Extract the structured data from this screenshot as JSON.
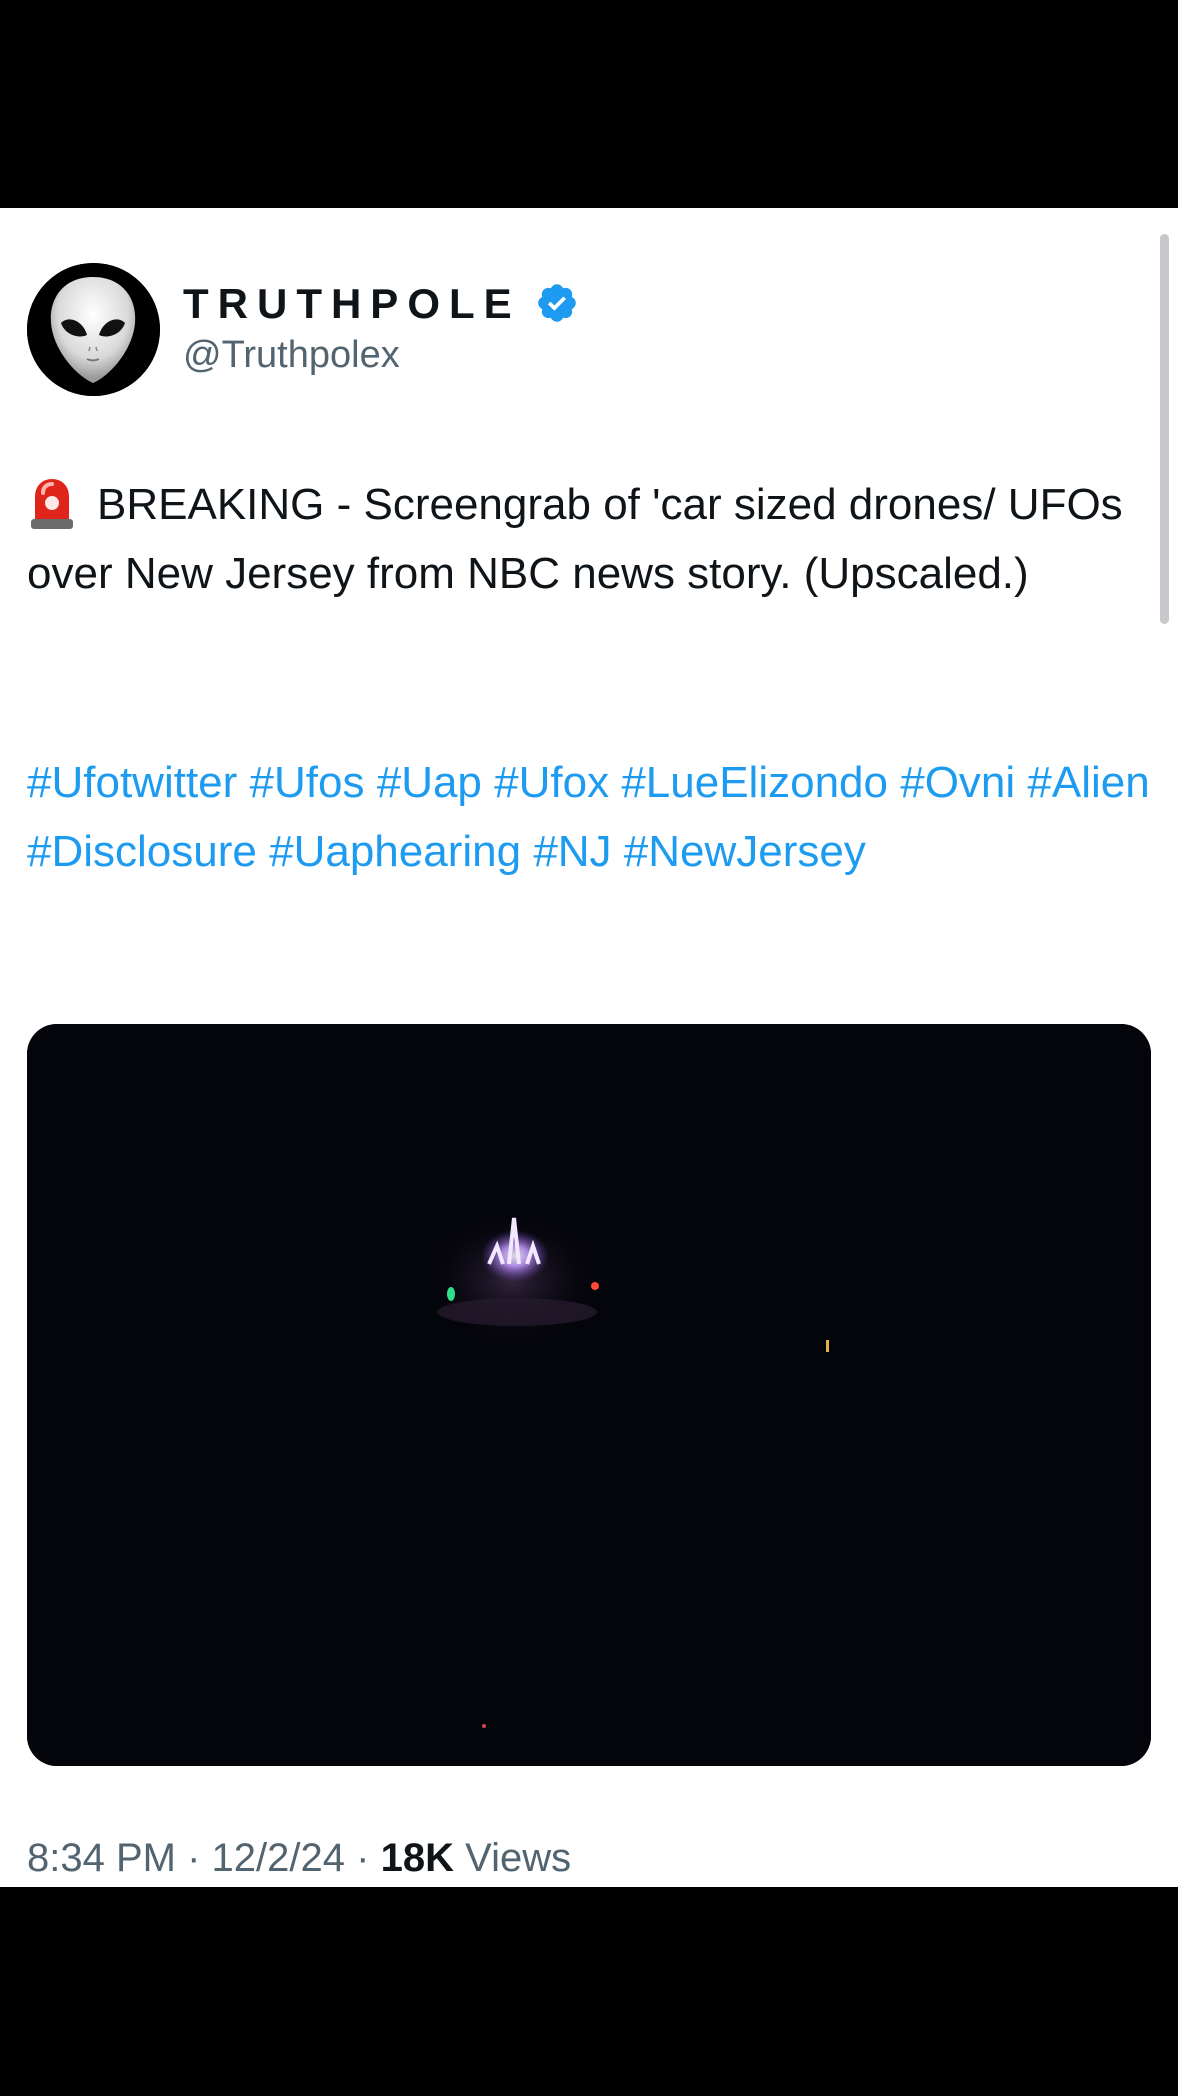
{
  "author": {
    "display_name": "TRUTHPOLE",
    "handle": "@Truthpolex",
    "verified": true,
    "avatar_icon": "alien-head-icon",
    "verified_icon": "verified-badge-icon"
  },
  "tweet": {
    "emoji_icon": "police-siren-icon",
    "text": "BREAKING - Screengrab of 'car sized drones/ UFOs over New Jersey from NBC news story. (Upscaled.)",
    "hashtags": [
      "#Ufotwitter",
      "#Ufos",
      "#Uap",
      "#Ufox",
      "#LueElizondo",
      "#Ovni",
      "#Alien",
      "#Disclosure",
      "#Uaphearing",
      "#NJ",
      "#NewJersey"
    ],
    "media_description_icon": "night-sky-photo"
  },
  "meta": {
    "time": "8:34 PM",
    "separator": "·",
    "date": "12/2/24",
    "views_count": "18K",
    "views_label": "Views"
  },
  "colors": {
    "link": "#1d9bf0",
    "text": "#0f1419",
    "secondary": "#536471",
    "verified": "#1d9bf0"
  }
}
